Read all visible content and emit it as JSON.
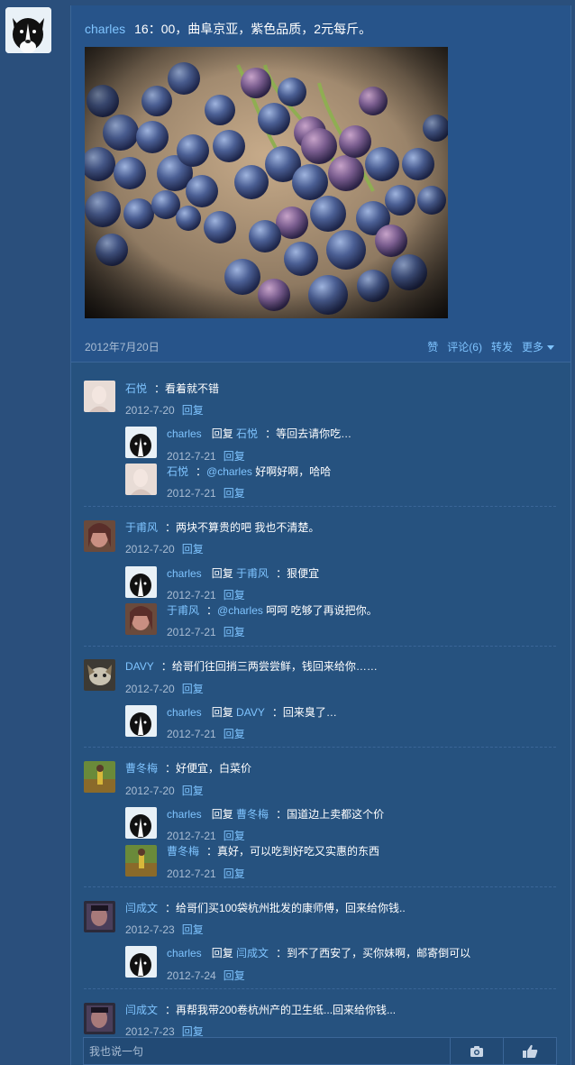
{
  "post": {
    "author": "charles",
    "text": "16：00，曲阜京亚，紫色品质，2元每斤。",
    "date": "2012年7月20日",
    "actions": {
      "like": "赞",
      "comment": "评论(6)",
      "share": "转发",
      "more": "更多"
    }
  },
  "reply_label": "回复",
  "colon": "：",
  "comments": [
    {
      "name": "石悦",
      "text": "看着就不错",
      "date": "2012-7-20",
      "replies": [
        {
          "name": "charles",
          "verb": "回复",
          "target": "石悦",
          "text": "等回去请你吃…",
          "date": "2012-7-21"
        },
        {
          "name": "石悦",
          "mention": "@charles",
          "text": " 好啊好啊，哈哈",
          "date": "2012-7-21"
        }
      ]
    },
    {
      "name": "于甫风",
      "text": "两块不算贵的吧 我也不清楚。",
      "date": "2012-7-20",
      "replies": [
        {
          "name": "charles",
          "verb": "回复",
          "target": "于甫风",
          "text": "狠便宜",
          "date": "2012-7-21"
        },
        {
          "name": "于甫风",
          "mention": "@charles",
          "text": " 呵呵 吃够了再说把你。",
          "date": "2012-7-21"
        }
      ]
    },
    {
      "name": "DAVY",
      "text": "给哥们往回捎三两尝尝鲜，钱回来给你……",
      "date": "2012-7-20",
      "replies": [
        {
          "name": "charles",
          "verb": "回复",
          "target": "DAVY",
          "text": "回来臭了…",
          "date": "2012-7-21"
        }
      ]
    },
    {
      "name": "曹冬梅",
      "text": "好便宜，白菜价",
      "date": "2012-7-20",
      "replies": [
        {
          "name": "charles",
          "verb": "回复",
          "target": "曹冬梅",
          "text": "国道边上卖都这个价",
          "date": "2012-7-21"
        },
        {
          "name": "曹冬梅",
          "text": "真好，可以吃到好吃又实惠的东西",
          "date": "2012-7-21"
        }
      ]
    },
    {
      "name": "闫成文",
      "text": "给哥们买100袋杭州批发的康师傅，回来给你钱..",
      "date": "2012-7-23",
      "replies": [
        {
          "name": "charles",
          "verb": "回复",
          "target": "闫成文",
          "text": "到不了西安了，买你妹啊，邮寄倒可以",
          "date": "2012-7-24"
        }
      ]
    },
    {
      "name": "闫成文",
      "text": "再帮我带200卷杭州产的卫生纸...回来给你钱...",
      "date": "2012-7-23",
      "replies": []
    }
  ],
  "input": {
    "placeholder": "我也说一句"
  },
  "icons": {
    "camera": "camera-icon",
    "like": "thumb-icon"
  },
  "colors": {
    "background": "#2a4f7c",
    "panel": "#27548a",
    "link": "#7fc4ff",
    "meta": "#a9bdd4"
  }
}
